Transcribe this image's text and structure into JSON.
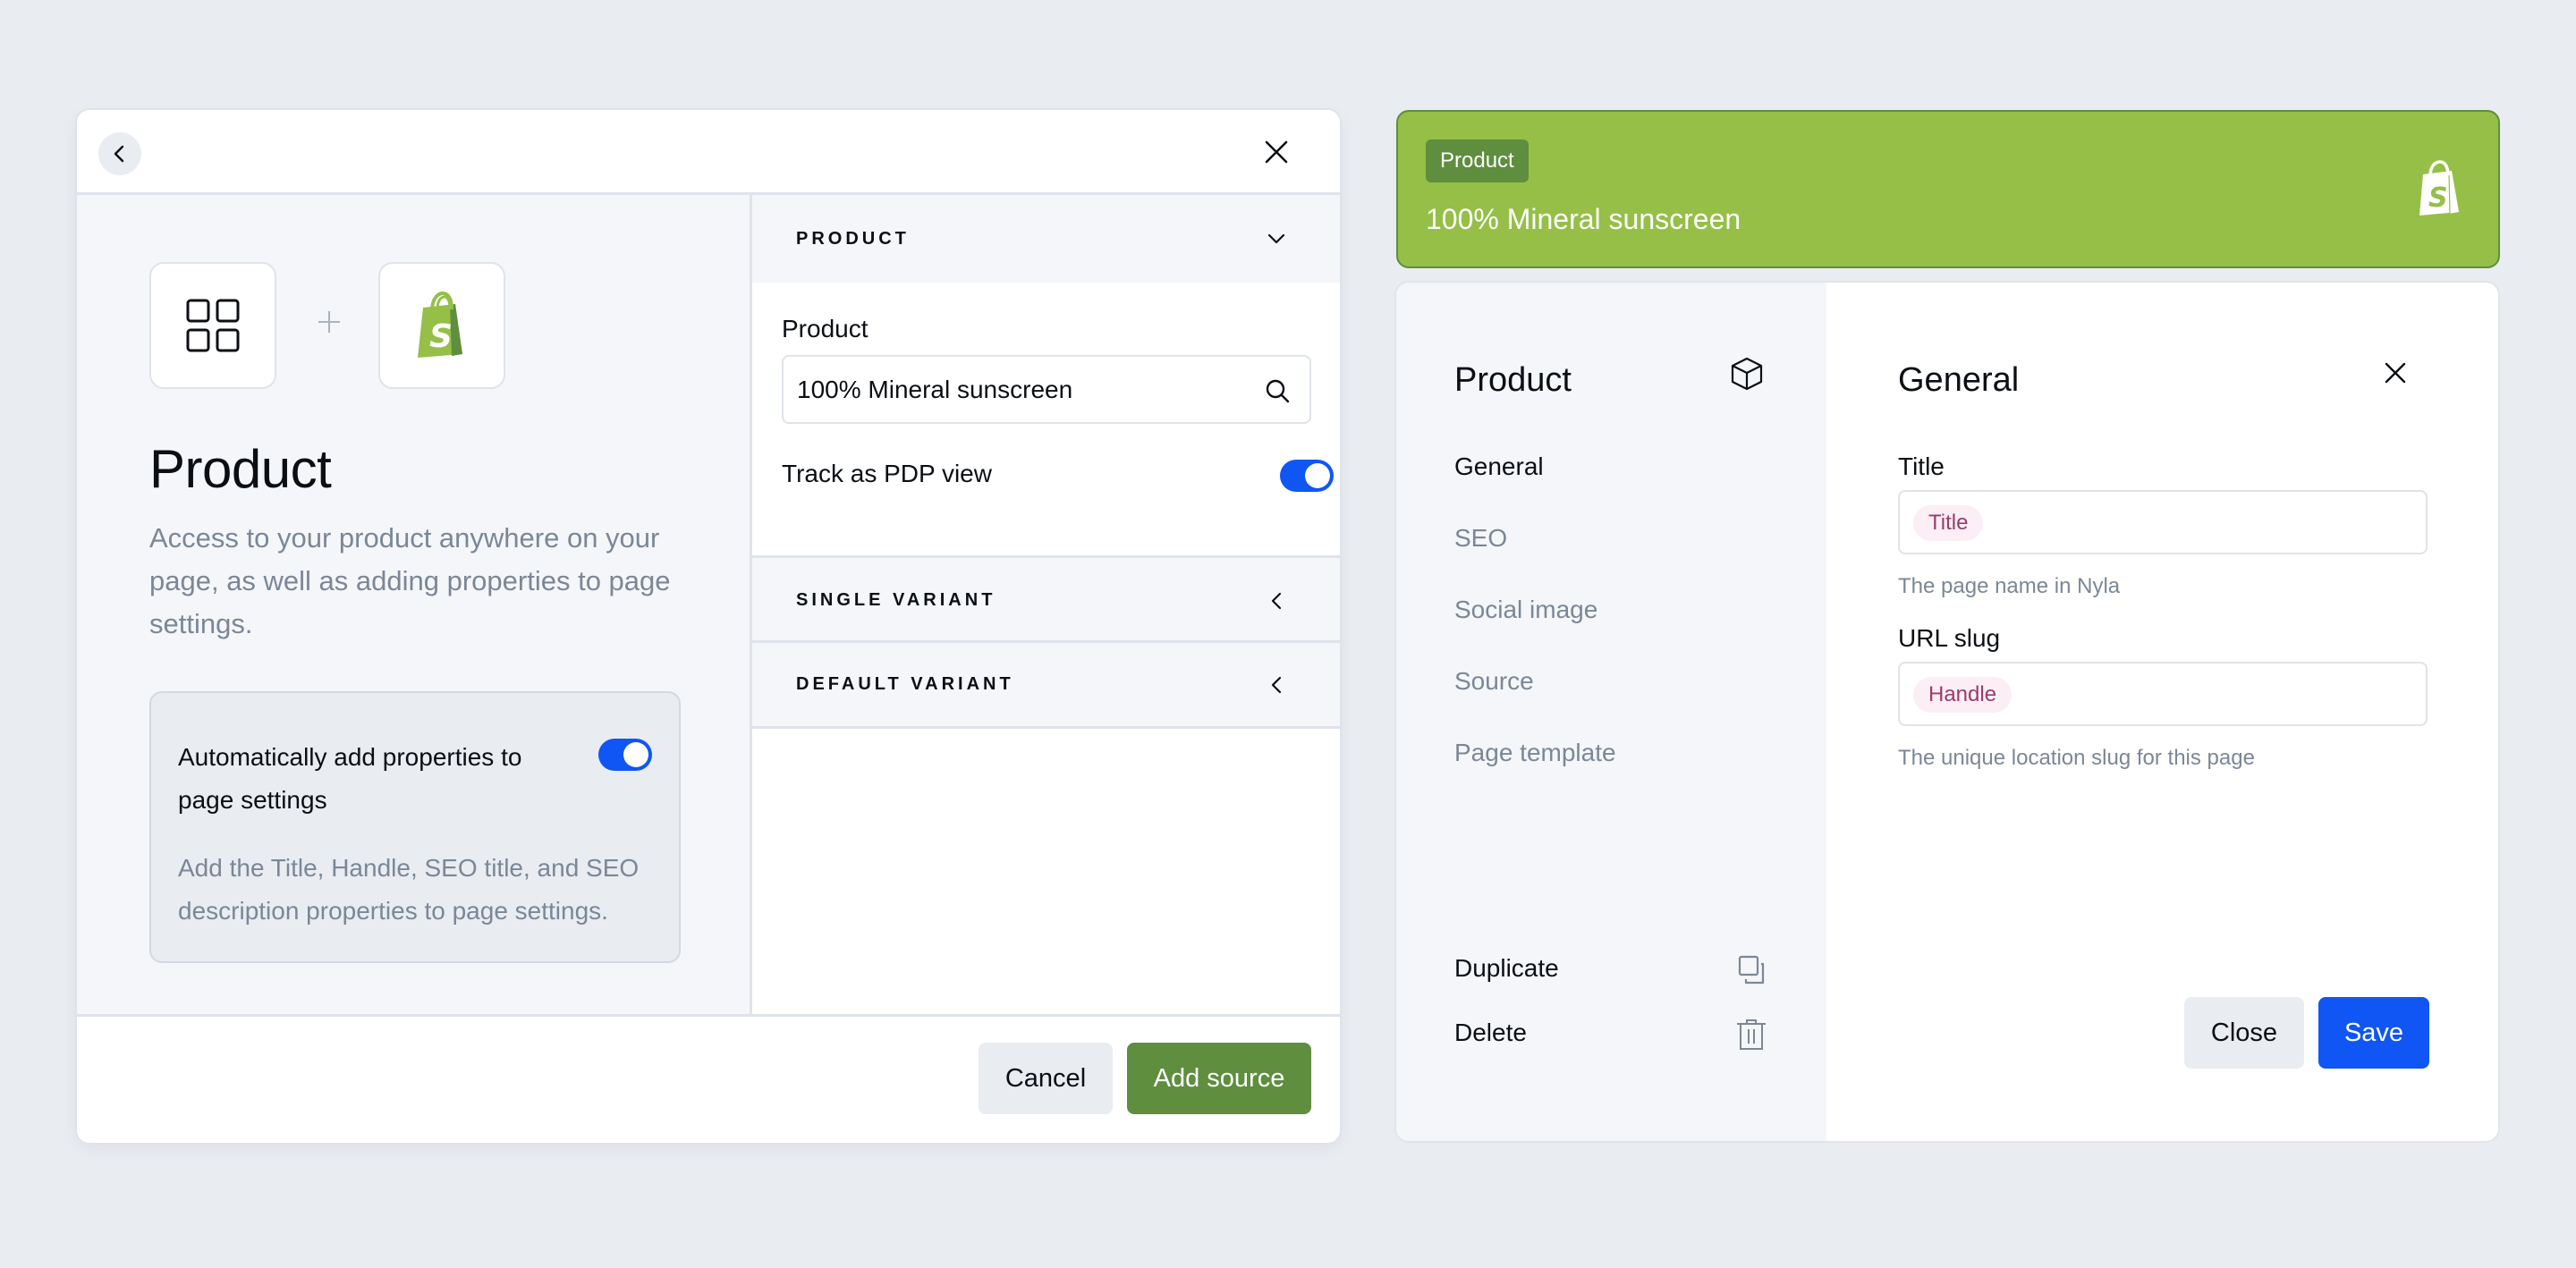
{
  "source_modal": {
    "header": {
      "back_icon": "chevron-left-icon",
      "close_icon": "close-icon"
    },
    "intro": {
      "app_icon": "grid-icon",
      "connector_icon": "plus-icon",
      "integration_icon": "shopify-bag-icon",
      "title": "Product",
      "description": "Access to your product anywhere on your page, as well as adding properties to page settings."
    },
    "auto_add": {
      "label": "Automatically add properties to page settings",
      "enabled": true,
      "description": "Add the Title, Handle, SEO title, and SEO description properties to page settings."
    },
    "sections": [
      {
        "label": "PRODUCT",
        "expanded": true,
        "icon": "chevron-down-icon"
      },
      {
        "label": "SINGLE VARIANT",
        "expanded": false,
        "icon": "chevron-left-icon"
      },
      {
        "label": "DEFAULT VARIANT",
        "expanded": false,
        "icon": "chevron-left-icon"
      }
    ],
    "product_field": {
      "label": "Product",
      "value": "100% Mineral sunscreen",
      "icon": "search-icon"
    },
    "track_pdp": {
      "label": "Track as PDP view",
      "enabled": true
    },
    "footer": {
      "cancel_label": "Cancel",
      "add_label": "Add source"
    }
  },
  "source_card": {
    "badge": "Product",
    "title": "100% Mineral sunscreen",
    "logo_icon": "shopify-bag-icon"
  },
  "settings_panel": {
    "sidebar": {
      "title": "Product",
      "title_icon": "cube-icon",
      "nav": [
        {
          "label": "General",
          "active": true
        },
        {
          "label": "SEO",
          "active": false
        },
        {
          "label": "Social image",
          "active": false
        },
        {
          "label": "Source",
          "active": false
        },
        {
          "label": "Page template",
          "active": false
        }
      ],
      "actions": [
        {
          "label": "Duplicate",
          "icon": "duplicate-icon"
        },
        {
          "label": "Delete",
          "icon": "trash-icon"
        }
      ]
    },
    "main": {
      "title": "General",
      "close_icon": "close-icon",
      "fields": [
        {
          "label": "Title",
          "token": "Title",
          "hint": "The page name in Nyla"
        },
        {
          "label": "URL slug",
          "token": "Handle",
          "hint": "The unique location slug for this page"
        }
      ],
      "close_label": "Close",
      "save_label": "Save"
    }
  },
  "colors": {
    "background": "#e9ecf1",
    "shopify_green": "#95bf47",
    "shopify_dark_green": "#5e8e3e",
    "primary_blue": "#0f56f5",
    "token_bg": "#fbeef5",
    "token_text": "#9b3b6c",
    "muted_text": "#7b8797"
  }
}
